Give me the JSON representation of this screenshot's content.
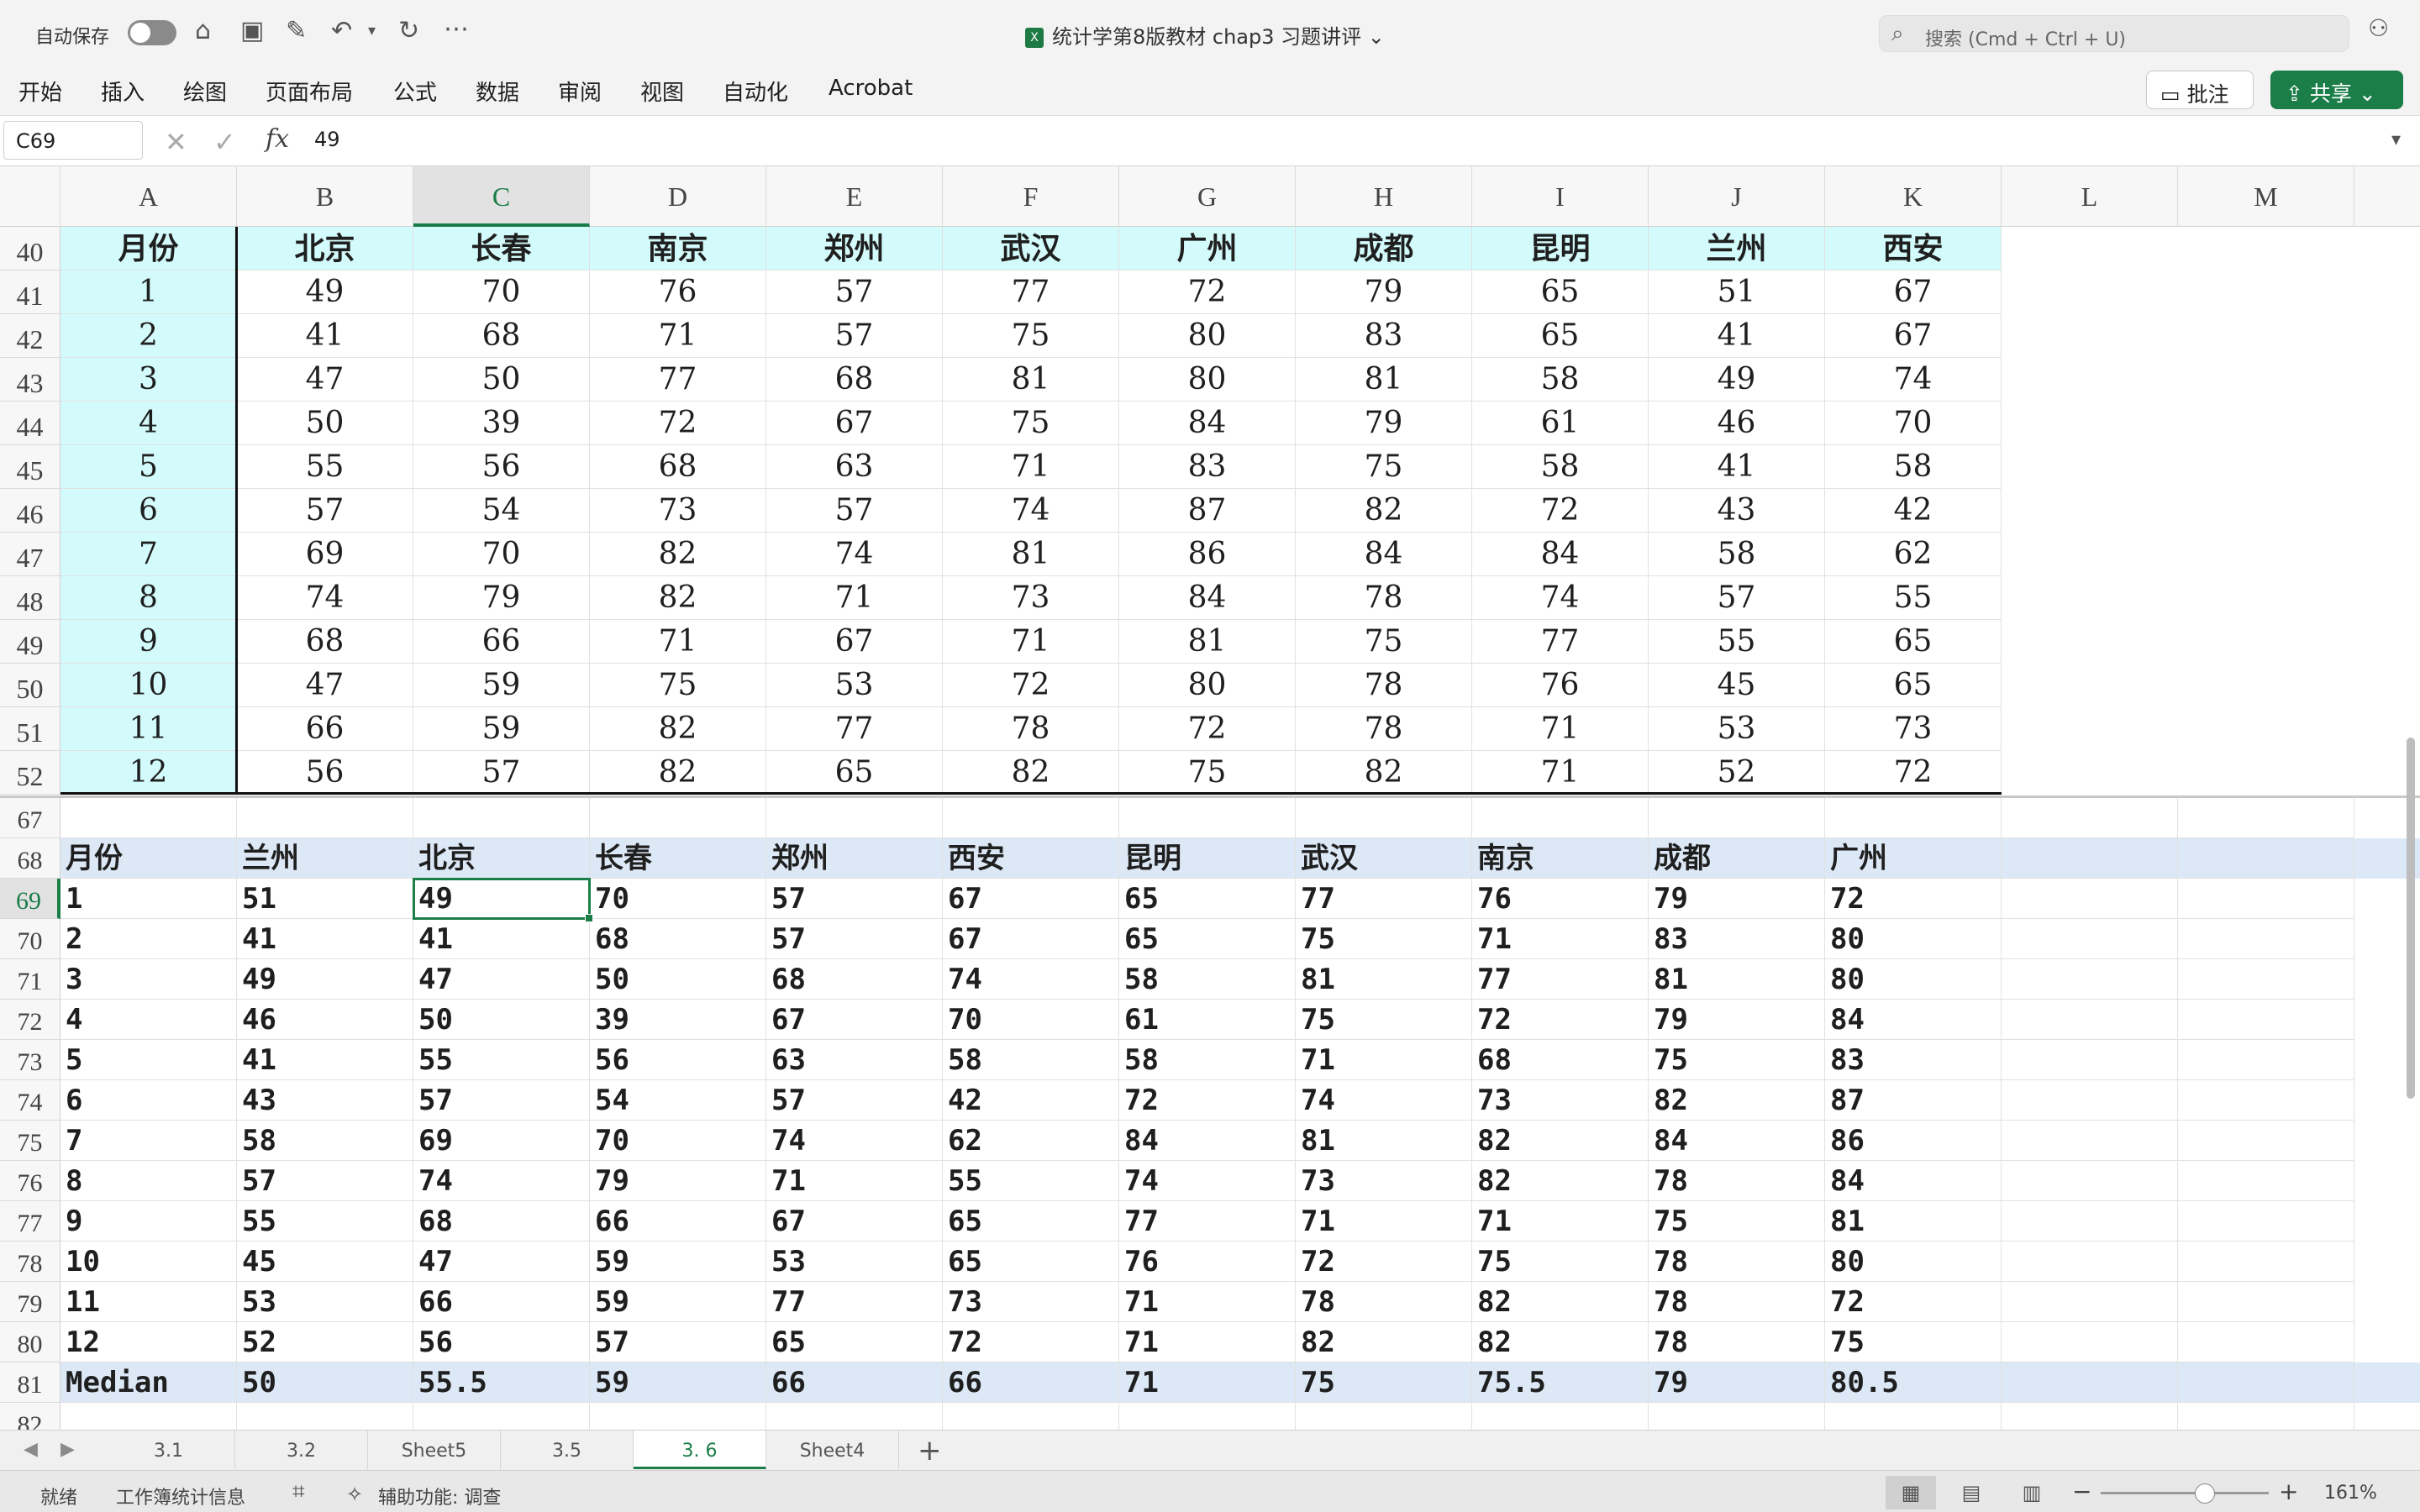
{
  "titlebar": {
    "autosave_label": "自动保存",
    "document_title": "统计学第8版教材 chap3 习题讲评",
    "xl_badge": "X",
    "search_placeholder": "搜索 (Cmd + Ctrl + U)"
  },
  "ribbon": {
    "tabs": [
      "开始",
      "插入",
      "绘图",
      "页面布局",
      "公式",
      "数据",
      "审阅",
      "视图",
      "自动化",
      "Acrobat"
    ],
    "comment_label": "批注",
    "share_label": "共享"
  },
  "formula_bar": {
    "name_box": "C69",
    "formula": "49"
  },
  "columns": [
    "A",
    "B",
    "C",
    "D",
    "E",
    "F",
    "G",
    "H",
    "I",
    "J",
    "K",
    "L",
    "M"
  ],
  "selected_column": "C",
  "selected_row": "69",
  "table1": {
    "header_row": "40",
    "headers": [
      "月份",
      "北京",
      "长春",
      "南京",
      "郑州",
      "武汉",
      "广州",
      "成都",
      "昆明",
      "兰州",
      "西安"
    ],
    "rows": [
      {
        "row": "41",
        "cells": [
          "1",
          "49",
          "70",
          "76",
          "57",
          "77",
          "72",
          "79",
          "65",
          "51",
          "67"
        ]
      },
      {
        "row": "42",
        "cells": [
          "2",
          "41",
          "68",
          "71",
          "57",
          "75",
          "80",
          "83",
          "65",
          "41",
          "67"
        ]
      },
      {
        "row": "43",
        "cells": [
          "3",
          "47",
          "50",
          "77",
          "68",
          "81",
          "80",
          "81",
          "58",
          "49",
          "74"
        ]
      },
      {
        "row": "44",
        "cells": [
          "4",
          "50",
          "39",
          "72",
          "67",
          "75",
          "84",
          "79",
          "61",
          "46",
          "70"
        ]
      },
      {
        "row": "45",
        "cells": [
          "5",
          "55",
          "56",
          "68",
          "63",
          "71",
          "83",
          "75",
          "58",
          "41",
          "58"
        ]
      },
      {
        "row": "46",
        "cells": [
          "6",
          "57",
          "54",
          "73",
          "57",
          "74",
          "87",
          "82",
          "72",
          "43",
          "42"
        ]
      },
      {
        "row": "47",
        "cells": [
          "7",
          "69",
          "70",
          "82",
          "74",
          "81",
          "86",
          "84",
          "84",
          "58",
          "62"
        ]
      },
      {
        "row": "48",
        "cells": [
          "8",
          "74",
          "79",
          "82",
          "71",
          "73",
          "84",
          "78",
          "74",
          "57",
          "55"
        ]
      },
      {
        "row": "49",
        "cells": [
          "9",
          "68",
          "66",
          "71",
          "67",
          "71",
          "81",
          "75",
          "77",
          "55",
          "65"
        ]
      },
      {
        "row": "50",
        "cells": [
          "10",
          "47",
          "59",
          "75",
          "53",
          "72",
          "80",
          "78",
          "76",
          "45",
          "65"
        ]
      },
      {
        "row": "51",
        "cells": [
          "11",
          "66",
          "59",
          "82",
          "77",
          "78",
          "72",
          "78",
          "71",
          "53",
          "73"
        ]
      },
      {
        "row": "52",
        "cells": [
          "12",
          "56",
          "57",
          "82",
          "65",
          "82",
          "75",
          "82",
          "71",
          "52",
          "72"
        ]
      }
    ]
  },
  "blank_row": "67",
  "table2": {
    "header_row": "68",
    "headers": [
      "月份",
      "兰州",
      "北京",
      "长春",
      "郑州",
      "西安",
      "昆明",
      "武汉",
      "南京",
      "成都",
      "广州"
    ],
    "rows": [
      {
        "row": "69",
        "cells": [
          "1",
          "51",
          "49",
          "70",
          "57",
          "67",
          "65",
          "77",
          "76",
          "79",
          "72"
        ]
      },
      {
        "row": "70",
        "cells": [
          "2",
          "41",
          "41",
          "68",
          "57",
          "67",
          "65",
          "75",
          "71",
          "83",
          "80"
        ]
      },
      {
        "row": "71",
        "cells": [
          "3",
          "49",
          "47",
          "50",
          "68",
          "74",
          "58",
          "81",
          "77",
          "81",
          "80"
        ]
      },
      {
        "row": "72",
        "cells": [
          "4",
          "46",
          "50",
          "39",
          "67",
          "70",
          "61",
          "75",
          "72",
          "79",
          "84"
        ]
      },
      {
        "row": "73",
        "cells": [
          "5",
          "41",
          "55",
          "56",
          "63",
          "58",
          "58",
          "71",
          "68",
          "75",
          "83"
        ]
      },
      {
        "row": "74",
        "cells": [
          "6",
          "43",
          "57",
          "54",
          "57",
          "42",
          "72",
          "74",
          "73",
          "82",
          "87"
        ]
      },
      {
        "row": "75",
        "cells": [
          "7",
          "58",
          "69",
          "70",
          "74",
          "62",
          "84",
          "81",
          "82",
          "84",
          "86"
        ]
      },
      {
        "row": "76",
        "cells": [
          "8",
          "57",
          "74",
          "79",
          "71",
          "55",
          "74",
          "73",
          "82",
          "78",
          "84"
        ]
      },
      {
        "row": "77",
        "cells": [
          "9",
          "55",
          "68",
          "66",
          "67",
          "65",
          "77",
          "71",
          "71",
          "75",
          "81"
        ]
      },
      {
        "row": "78",
        "cells": [
          "10",
          "45",
          "47",
          "59",
          "53",
          "65",
          "76",
          "72",
          "75",
          "78",
          "80"
        ]
      },
      {
        "row": "79",
        "cells": [
          "11",
          "53",
          "66",
          "59",
          "77",
          "73",
          "71",
          "78",
          "82",
          "78",
          "72"
        ]
      },
      {
        "row": "80",
        "cells": [
          "12",
          "52",
          "56",
          "57",
          "65",
          "72",
          "71",
          "82",
          "82",
          "78",
          "75"
        ]
      }
    ],
    "median_row": {
      "row": "81",
      "cells": [
        "Median",
        "50",
        "55.5",
        "59",
        "66",
        "66",
        "71",
        "75",
        "75.5",
        "79",
        "80.5"
      ]
    },
    "partial_row": "82"
  },
  "sheet_tabs": [
    "3.1",
    "3.2",
    "Sheet5",
    "3.5",
    "3. 6",
    "Sheet4"
  ],
  "active_sheet": "3. 6",
  "status_bar": {
    "ready": "就绪",
    "workbook_stats": "工作簿统计信息",
    "accessibility": "辅助功能: 调查",
    "zoom": "161%",
    "zoom_level_fraction": 0.62
  },
  "colors": {
    "accent_green": "#1b7d48",
    "header_cyan": "#d4fbfb",
    "row_highlight_blue": "#dde8f6"
  }
}
